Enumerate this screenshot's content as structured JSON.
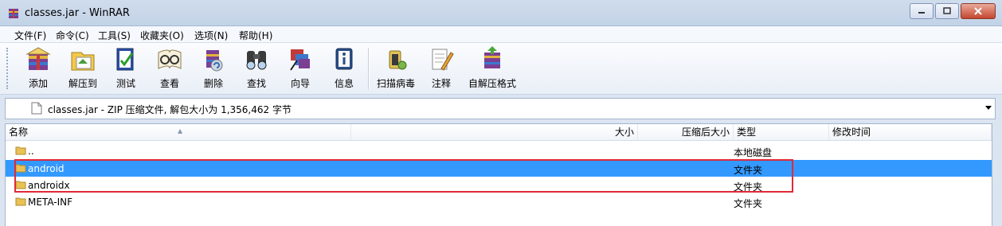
{
  "window": {
    "title": "classes.jar - WinRAR"
  },
  "menu": [
    "文件(F)",
    "命令(C)",
    "工具(S)",
    "收藏夹(O)",
    "选项(N)",
    "帮助(H)"
  ],
  "toolbar": [
    {
      "label": "添加",
      "icon": "add-archive-icon"
    },
    {
      "label": "解压到",
      "icon": "extract-to-icon"
    },
    {
      "label": "测试",
      "icon": "test-icon"
    },
    {
      "label": "查看",
      "icon": "view-icon"
    },
    {
      "label": "删除",
      "icon": "delete-icon"
    },
    {
      "label": "查找",
      "icon": "find-icon"
    },
    {
      "label": "向导",
      "icon": "wizard-icon"
    },
    {
      "label": "信息",
      "icon": "info-icon"
    },
    {
      "label": "扫描病毒",
      "icon": "virus-scan-icon"
    },
    {
      "label": "注释",
      "icon": "comment-icon"
    },
    {
      "label": "自解压格式",
      "icon": "sfx-icon"
    }
  ],
  "pathbar": {
    "text": "classes.jar - ZIP 压缩文件, 解包大小为 1,356,462 字节"
  },
  "columns": {
    "name": "名称",
    "size": "大小",
    "packed": "压缩后大小",
    "type": "类型",
    "modified": "修改时间"
  },
  "rows": [
    {
      "name": "..",
      "type": "本地磁盘",
      "selected": false
    },
    {
      "name": "android",
      "type": "文件夹",
      "selected": true
    },
    {
      "name": "androidx",
      "type": "文件夹",
      "selected": false
    },
    {
      "name": "META-INF",
      "type": "文件夹",
      "selected": false
    }
  ],
  "colors": {
    "selection": "#3399ff",
    "annotation_box": "#e0293b"
  }
}
